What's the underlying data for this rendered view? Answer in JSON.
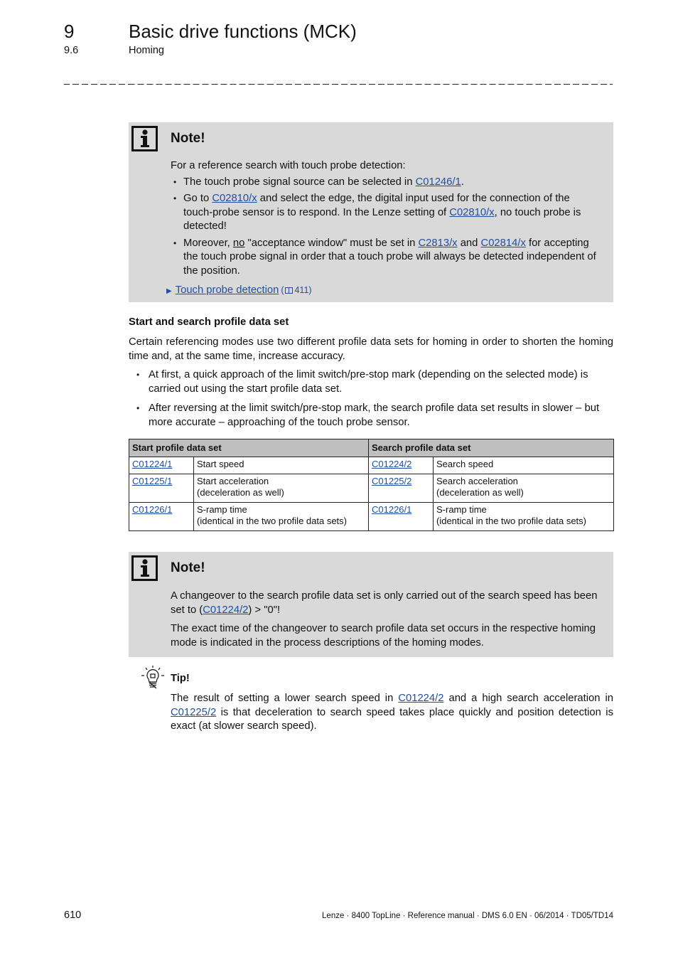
{
  "header": {
    "chapter_number": "9",
    "chapter_title": "Basic drive functions (MCK)",
    "section_number": "9.6",
    "section_title": "Homing"
  },
  "note1": {
    "title": "Note!",
    "intro": "For a reference search with touch probe detection:",
    "bullet1": {
      "pre": "The touch probe signal source can be selected in ",
      "link": "C01246/1",
      "post": "."
    },
    "bullet2": {
      "pre": "Go to ",
      "link1": "C02810/x",
      "mid": " and select the edge, the digital input used for the connection of the touch-probe sensor is to respond. In the Lenze setting of ",
      "link2": "C02810/x",
      "post": ", no touch probe is detected!"
    },
    "bullet3": {
      "pre": "Moreover, ",
      "emph": "no",
      "mid1": " \"acceptance window\" must be set in ",
      "link1": "C2813/x",
      "mid2": " and ",
      "link2": "C02814/x",
      "post": " for accepting the touch probe signal in order that a touch probe will always be detected independent of the position."
    },
    "xref": {
      "label": "Touch probe detection",
      "page_prefix": "(",
      "page_icon": "🕮",
      "page": "411",
      "page_suffix": ")"
    }
  },
  "section": {
    "heading": "Start and search profile data set",
    "intro": "Certain referencing modes use two different profile data sets for homing in order to shorten the homing time and, at the same time, increase accuracy.",
    "bullets": [
      "At first, a quick approach of the limit switch/pre-stop mark (depending on the selected mode) is carried out using the start profile data set.",
      "After reversing at the limit switch/pre-stop mark, the search profile data set results in slower – but more accurate – approaching of the touch probe sensor."
    ]
  },
  "table": {
    "headers": [
      "Start profile data set",
      "Search profile data set"
    ],
    "rows": [
      {
        "start_code": "C01224/1",
        "start_desc": "Start speed",
        "start_desc2": "",
        "search_code": "C01224/2",
        "search_desc": "Search speed",
        "search_desc2": ""
      },
      {
        "start_code": "C01225/1",
        "start_desc": "Start acceleration",
        "start_desc2": "(deceleration as well)",
        "search_code": "C01225/2",
        "search_desc": "Search acceleration",
        "search_desc2": "(deceleration as well)"
      },
      {
        "start_code": "C01226/1",
        "start_desc": "S-ramp time",
        "start_desc2": "(identical in the two profile data sets)",
        "search_code": "C01226/1",
        "search_desc": "S-ramp time",
        "search_desc2": "(identical in the two profile data sets)"
      }
    ]
  },
  "note2": {
    "title": "Note!",
    "p1": {
      "pre": "A changeover to the search profile data set is only carried out of the search speed has been set to (",
      "link": "C01224/2",
      "post": ") > \"0\"!"
    },
    "p2": "The exact time of the changeover to search profile data set occurs in the respective homing mode is indicated in the process descriptions of the homing modes."
  },
  "tip": {
    "title": "Tip!",
    "pre": "The result of setting a lower search speed in ",
    "link1": "C01224/2",
    "mid": " and a high search acceleration in ",
    "link2": "C01225/2",
    "post": " is that deceleration to search speed takes place quickly and position detection is exact (at slower search speed)."
  },
  "footer": {
    "page_number": "610",
    "text": "Lenze · 8400 TopLine · Reference manual · DMS 6.0 EN · 06/2014 · TD05/TD14"
  }
}
